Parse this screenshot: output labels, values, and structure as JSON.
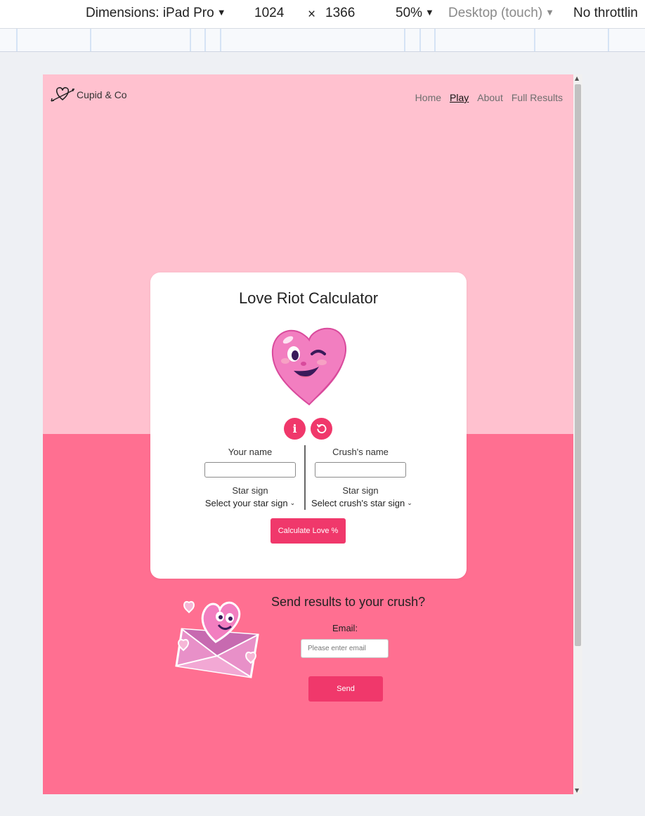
{
  "devtools": {
    "dimensions_label": "Dimensions: iPad Pro",
    "width": "1024",
    "times": "×",
    "height": "1366",
    "zoom": "50%",
    "device_mode": "Desktop (touch)",
    "throttling": "No throttlin"
  },
  "nav": {
    "brand": "Cupid & Co",
    "links": [
      "Home",
      "Play",
      "About",
      "Full Results"
    ],
    "active": "Play"
  },
  "card": {
    "title": "Love Riot Calculator",
    "info_icon": "info-icon",
    "reset_icon": "reset-icon",
    "your_name_label": "Your name",
    "crush_name_label": "Crush's name",
    "star_sign_label": "Star sign",
    "your_star_select": "Select your star sign",
    "crush_star_select": "Select crush's star sign",
    "calculate_label": "Calculate Love %"
  },
  "send": {
    "title": "Send results to your crush?",
    "email_label": "Email:",
    "email_placeholder": "Please enter email",
    "send_label": "Send"
  },
  "colors": {
    "top_bg": "#ffc1cf",
    "bottom_bg": "#ff6f91",
    "accent": "#f0386b"
  }
}
